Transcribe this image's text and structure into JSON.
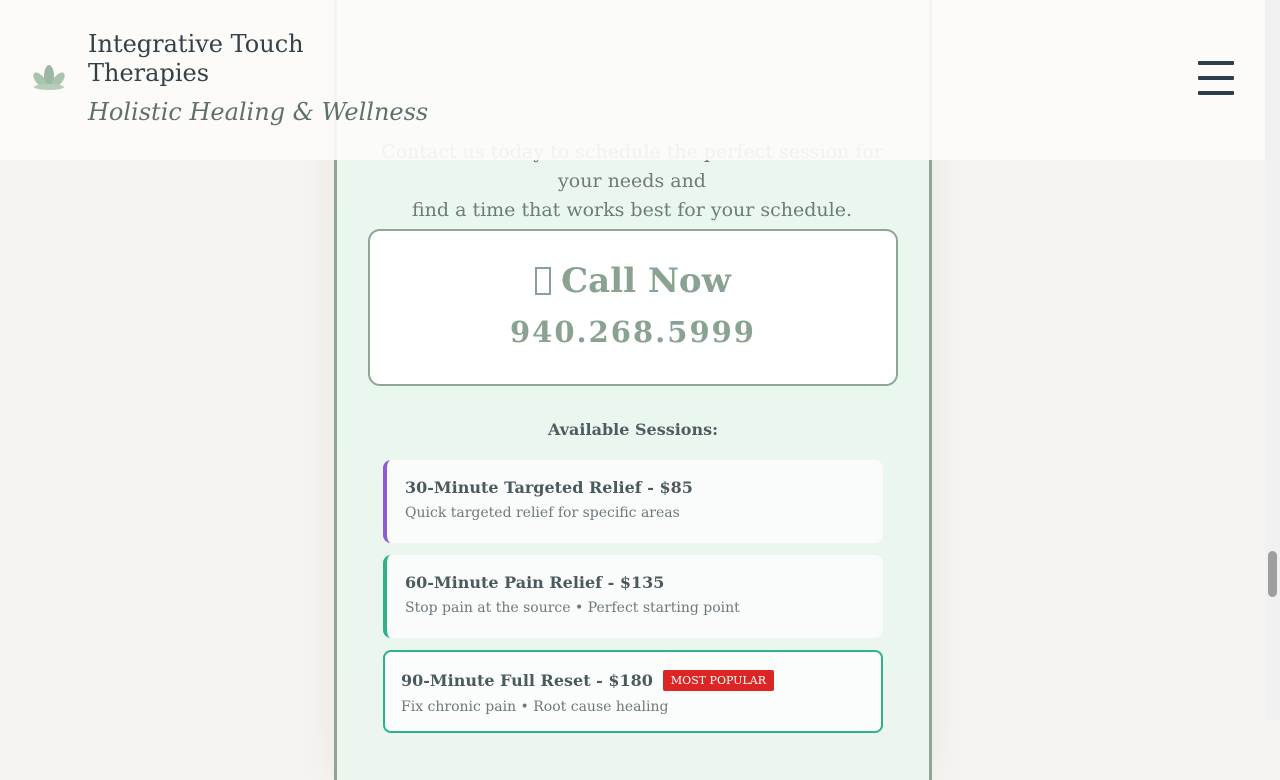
{
  "header": {
    "brand": "Integrative Touch Therapies",
    "tagline": "Holistic Healing & Wellness",
    "logo_icon": "lotus-icon",
    "menu_icon": "hamburger-menu-icon"
  },
  "intro": {
    "partial_line": "Contact us today to schedule the perfect session for your needs and",
    "line": "find a time that works best for your schedule."
  },
  "call": {
    "icon": "phone-icon",
    "title": "Call Now",
    "phone": "940.268.5999"
  },
  "sessions": {
    "heading": "Available Sessions:",
    "items": [
      {
        "title": "30-Minute Targeted Relief - $85",
        "desc": "Quick targeted relief for specific areas"
      },
      {
        "title": "60-Minute Pain Relief - $135",
        "desc": "Stop pain at the source • Perfect starting point"
      },
      {
        "title": "90-Minute Full Reset - $180",
        "badge": "MOST POPULAR",
        "desc": "Fix chronic pain • Root cause healing"
      }
    ]
  },
  "colors": {
    "accent": "#8aa290",
    "purple": "#8b5cd6",
    "green": "#2fb386",
    "badge": "#dc2626"
  }
}
